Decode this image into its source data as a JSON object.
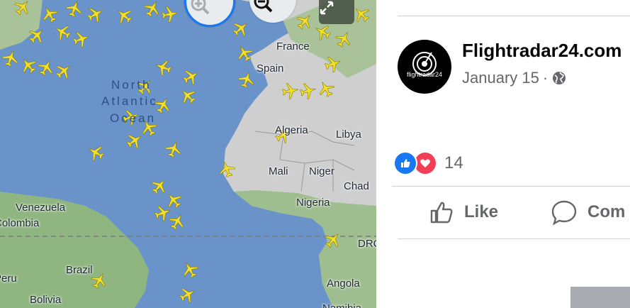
{
  "map": {
    "colors": {
      "ocean": "#6a93c9",
      "land": "#c9c9c9",
      "greenLand": "#95b88a",
      "plane": "#f3e02b"
    },
    "ocean_label": {
      "line1": "North",
      "line2": "Atlantic",
      "line3": "Ocean"
    },
    "country_labels": [
      "France",
      "Spain",
      "Algeria",
      "Libya",
      "Mali",
      "Niger",
      "Chad",
      "Nigeria",
      "DRC",
      "Angola",
      "Venezuela",
      "Colombia",
      "Brazil",
      "Bolivia",
      "Peru",
      "Namibia"
    ],
    "zoom_in_icon": "zoom-in-icon",
    "zoom_out_icon": "zoom-out-icon",
    "fullscreen_icon": "expand-icon"
  },
  "post": {
    "page_name": "Flightradar24.com",
    "avatar_text": "flightradar24",
    "date": "January 15",
    "separator": "·",
    "privacy_icon": "globe-icon",
    "reaction_count": "14",
    "reaction_icons": [
      "like-icon",
      "love-icon"
    ],
    "colors": {
      "like": "#1877f2",
      "love": "#f33e58",
      "secondaryText": "#65676b"
    },
    "actions": {
      "like_label": "Like",
      "comment_label": "Com"
    }
  }
}
